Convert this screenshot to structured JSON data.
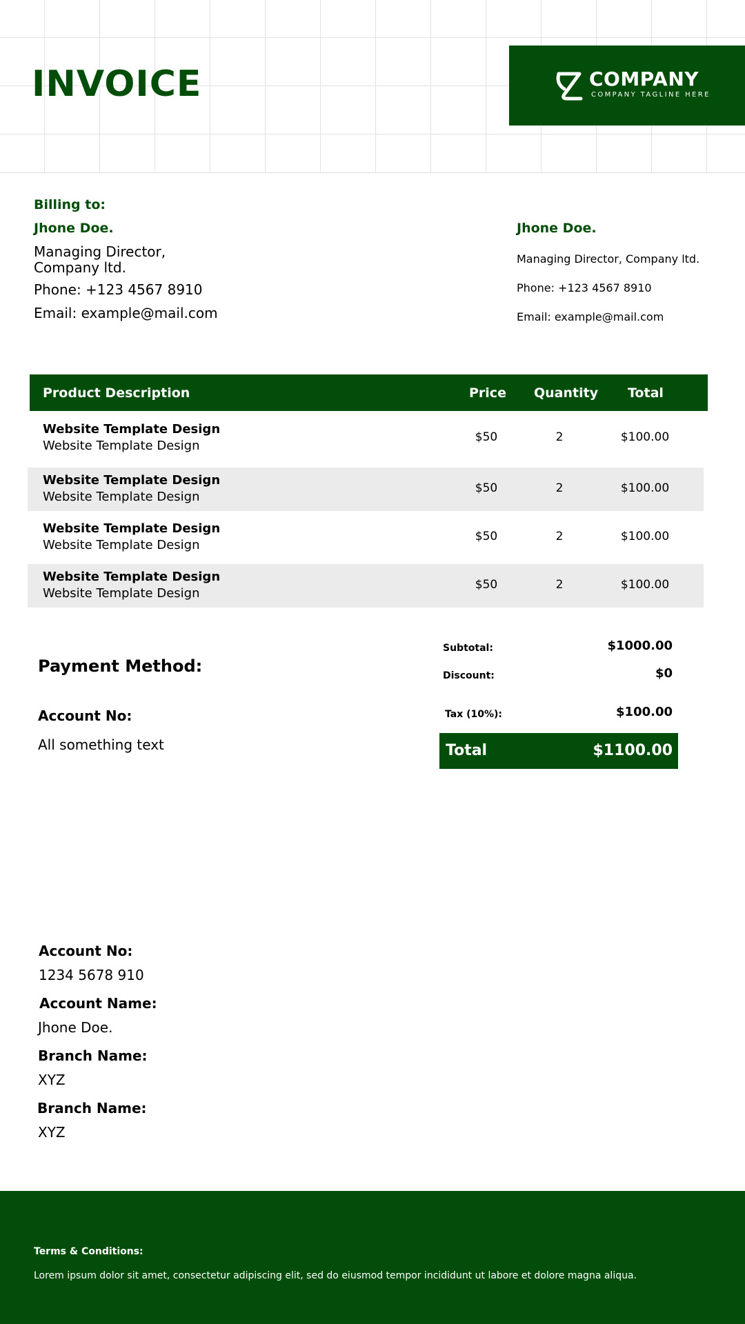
{
  "header": {
    "title": "INVOICE",
    "brand": {
      "name": "COMPANY",
      "tagline": "COMPANY TAGLINE HERE",
      "logo_icon": "company-logo-icon"
    }
  },
  "billing": {
    "label": "Billing to:",
    "name": "Jhone Doe.",
    "role_line1": "Managing Director,",
    "role_line2": "Company ltd.",
    "phone": "Phone: +123 4567 8910",
    "email": "Email: example@mail.com"
  },
  "sender": {
    "name": "Jhone Doe.",
    "role": "Managing Director,  Company ltd.",
    "phone": "Phone: +123 4567 8910",
    "email": "Email: example@mail.com"
  },
  "table": {
    "headers": {
      "description": "Product Description",
      "price": "Price",
      "quantity": "Quantity",
      "total": "Total"
    },
    "rows": [
      {
        "title": "Website Template Design",
        "subtitle": "Website Template Design",
        "price": "$50",
        "quantity": "2",
        "total": "$100.00"
      },
      {
        "title": "Website Template Design",
        "subtitle": "Website Template Design",
        "price": "$50",
        "quantity": "2",
        "total": "$100.00"
      },
      {
        "title": "Website Template Design",
        "subtitle": "Website Template Design",
        "price": "$50",
        "quantity": "2",
        "total": "$100.00"
      },
      {
        "title": "Website Template Design",
        "subtitle": "Website Template Design",
        "price": "$50",
        "quantity": "2",
        "total": "$100.00"
      }
    ]
  },
  "payment": {
    "title": "Payment Method:",
    "account_label": "Account No:",
    "account_text": "All something text"
  },
  "summary": {
    "subtotal_label": "Subtotal:",
    "subtotal_value": "$1000.00",
    "discount_label": "Discount:",
    "discount_value": "$0",
    "tax_label": "Tax (10%):",
    "tax_value": "$100.00",
    "total_label": "Total",
    "total_value": "$1100.00"
  },
  "account": {
    "account_no_label": "Account No:",
    "account_no_value": "1234 5678 910",
    "account_name_label": "Account Name:",
    "account_name_value": "Jhone Doe.",
    "branch1_label": "Branch Name:",
    "branch1_value": "XYZ",
    "branch2_label": "Branch Name:",
    "branch2_value": "XYZ"
  },
  "footer": {
    "terms_title": "Terms & Conditions:",
    "terms_text": "Lorem ipsum dolor sit amet, consectetur adipiscing elit, sed do eiusmod tempor incididunt ut labore et dolore magna aliqua."
  },
  "colors": {
    "brand_green": "#034d0a",
    "row_alt": "#ebebeb",
    "grid_line": "#e1e3e1"
  }
}
